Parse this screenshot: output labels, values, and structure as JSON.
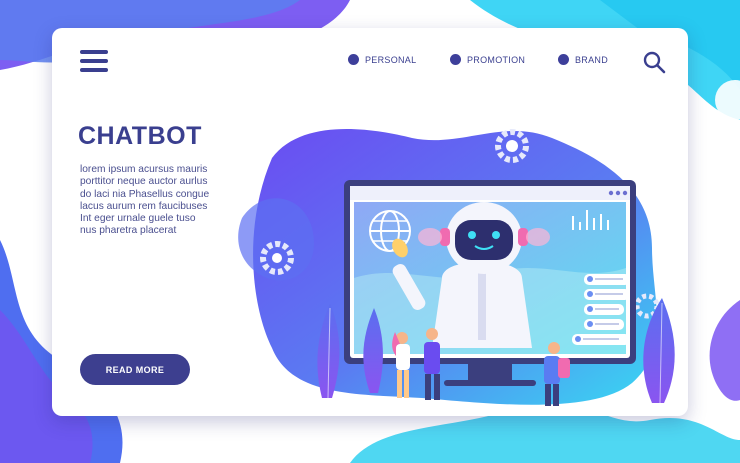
{
  "header": {
    "nav": [
      {
        "label": "PERSONAL"
      },
      {
        "label": "PROMOTION"
      },
      {
        "label": "BRAND"
      }
    ]
  },
  "hero": {
    "title": "CHATBOT",
    "description": "lorem ipsum acursus mauris porttitor neque auctor aurlus do laci nia Phasellus congue lacus aurum rem faucibuses Int eger urnale guele tuso nus pharetra placerat",
    "cta_label": "READ MORE"
  },
  "colors": {
    "accent": "#3d3f8f",
    "purple": "#6a4cf0",
    "cyan": "#33e6f2"
  }
}
